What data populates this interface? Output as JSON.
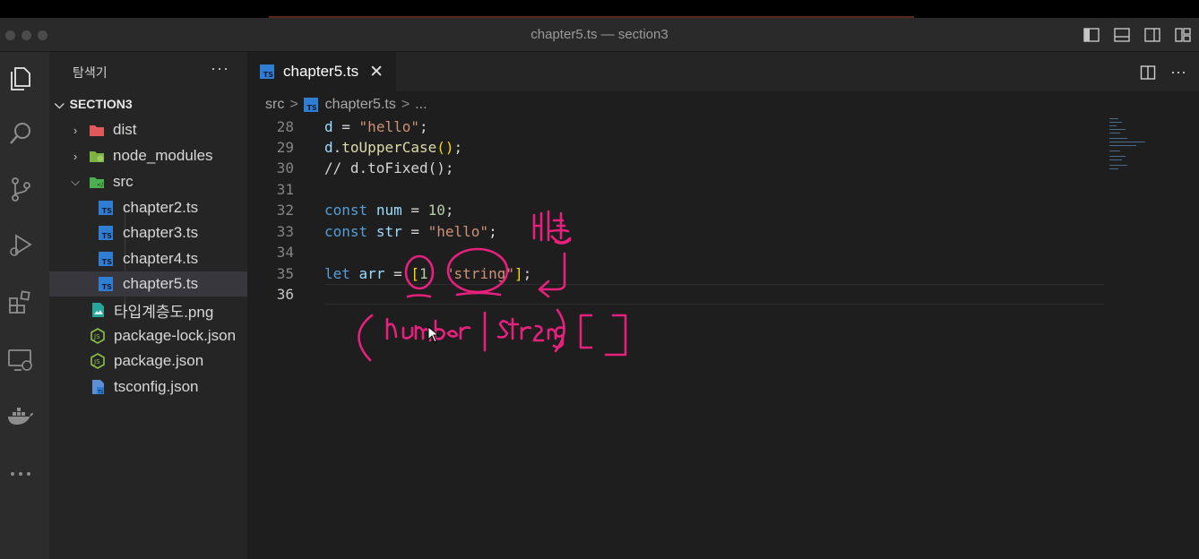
{
  "window": {
    "title": "chapter5.ts — section3"
  },
  "explorer": {
    "title": "탐색기",
    "more": "···",
    "section": "SECTION3",
    "items": [
      {
        "label": "dist",
        "type": "folder",
        "icon": "folder-dist-icon",
        "expanded": false
      },
      {
        "label": "node_modules",
        "type": "folder",
        "icon": "folder-node-icon",
        "expanded": false
      },
      {
        "label": "src",
        "type": "folder",
        "icon": "folder-src-icon",
        "expanded": true
      },
      {
        "label": "chapter2.ts",
        "type": "ts-file",
        "icon": "typescript-file-icon"
      },
      {
        "label": "chapter3.ts",
        "type": "ts-file",
        "icon": "typescript-file-icon"
      },
      {
        "label": "chapter4.ts",
        "type": "ts-file",
        "icon": "typescript-file-icon"
      },
      {
        "label": "chapter5.ts",
        "type": "ts-file",
        "icon": "typescript-file-icon",
        "selected": true
      },
      {
        "label": "타입계층도.png",
        "type": "image",
        "icon": "image-file-icon"
      },
      {
        "label": "package-lock.json",
        "type": "json",
        "icon": "nodejs-file-icon"
      },
      {
        "label": "package.json",
        "type": "json",
        "icon": "nodejs-file-icon"
      },
      {
        "label": "tsconfig.json",
        "type": "tsconfig",
        "icon": "tsconfig-file-icon"
      }
    ]
  },
  "tab": {
    "label": "chapter5.ts",
    "badge": "TS",
    "close": "✕"
  },
  "editor_actions": {
    "more": "···"
  },
  "breadcrumb": {
    "folder": "src",
    "file": "chapter5.ts",
    "sep": ">",
    "tail": "..."
  },
  "code": {
    "line_numbers": [
      "28",
      "29",
      "30",
      "31",
      "32",
      "33",
      "34",
      "35",
      "36"
    ],
    "active_line": "36"
  },
  "annotation": {
    "korean_note": "배열",
    "handwritten": "(number | string)[]"
  },
  "colors": {
    "ink": "#e6217d",
    "accent_ts": "#2f7ed3",
    "keyword": "#569cd6",
    "string": "#ce9178",
    "number": "#b5cea8",
    "comment": "#6a9955"
  }
}
